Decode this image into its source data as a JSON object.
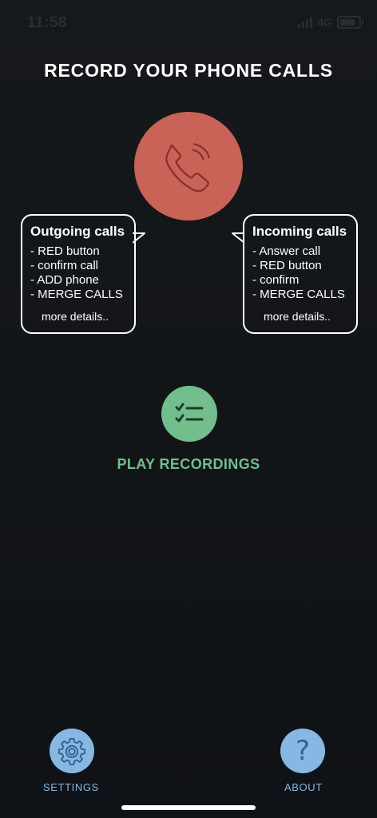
{
  "status_bar": {
    "time": "11:58",
    "network": "4G"
  },
  "title": "RECORD YOUR PHONE CALLS",
  "outgoing": {
    "title": "Outgoing calls",
    "lines": [
      "- RED button",
      "- confirm call",
      "- ADD phone",
      "- MERGE CALLS"
    ],
    "more": "more details.."
  },
  "incoming": {
    "title": "Incoming calls",
    "lines": [
      "- Answer call",
      "- RED button",
      "- confirm",
      "- MERGE CALLS"
    ],
    "more": "more details.."
  },
  "recordings": {
    "label": "PLAY RECORDINGS"
  },
  "bottom": {
    "settings_label": "SETTINGS",
    "about_label": "ABOUT",
    "about_icon": "?"
  },
  "colors": {
    "record": "#c96257",
    "recordings": "#72be8d",
    "nav": "#86b8e3"
  },
  "icons": {
    "record": "phone-icon",
    "recordings": "checklist-icon",
    "settings": "gear-icon",
    "about": "question-icon"
  }
}
